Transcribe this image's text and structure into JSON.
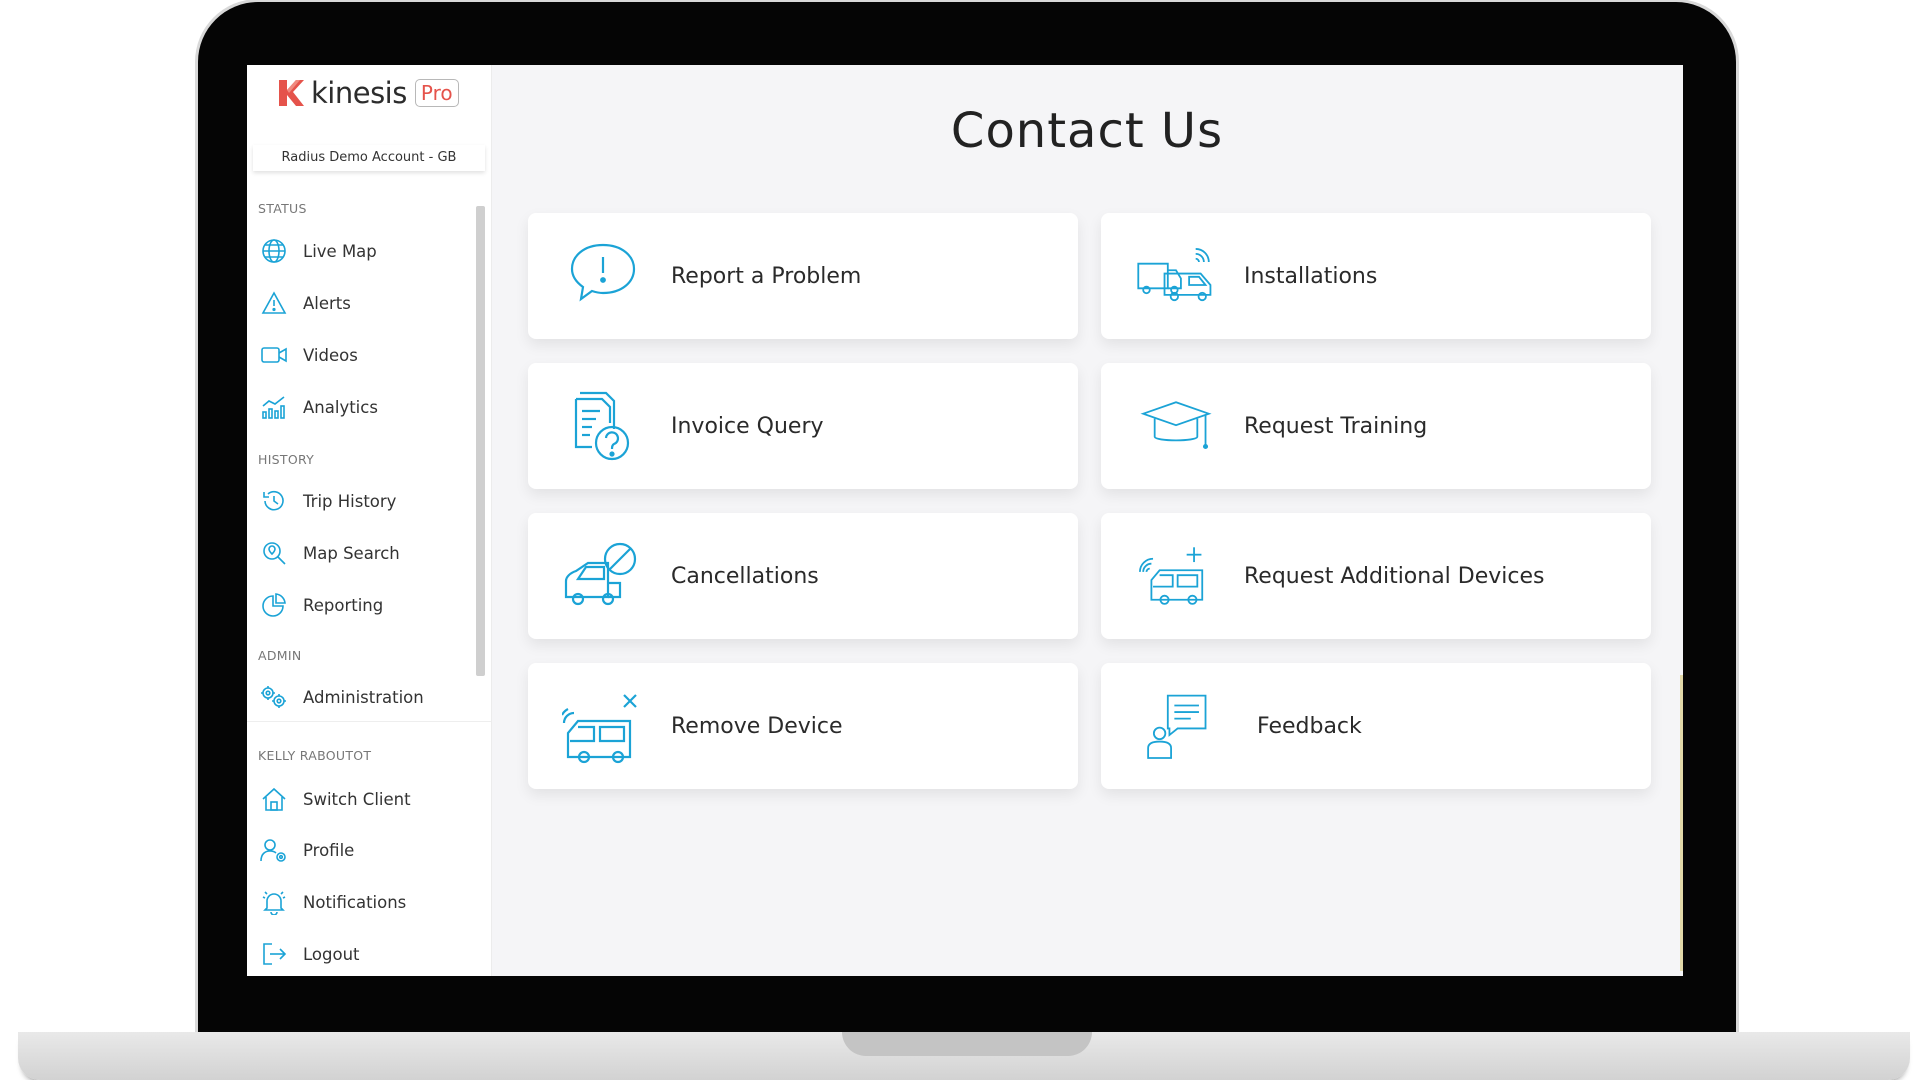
{
  "app": {
    "logo_text": "kinesis",
    "logo_badge": "Pro",
    "account": "Radius Demo Account - GB"
  },
  "sidebar": {
    "sections": [
      {
        "label": "STATUS",
        "items": [
          {
            "label": "Live Map",
            "icon": "globe-icon"
          },
          {
            "label": "Alerts",
            "icon": "warning-icon"
          },
          {
            "label": "Videos",
            "icon": "video-camera-icon"
          },
          {
            "label": "Analytics",
            "icon": "analytics-chart-icon"
          }
        ]
      },
      {
        "label": "HISTORY",
        "items": [
          {
            "label": "Trip History",
            "icon": "history-clock-icon"
          },
          {
            "label": "Map Search",
            "icon": "map-search-icon"
          },
          {
            "label": "Reporting",
            "icon": "pie-chart-icon"
          }
        ]
      },
      {
        "label": "ADMIN",
        "items": [
          {
            "label": "Administration",
            "icon": "gears-icon"
          }
        ]
      },
      {
        "label": "KELLY RABOUTOT",
        "items": [
          {
            "label": "Switch Client",
            "icon": "home-icon"
          },
          {
            "label": "Profile",
            "icon": "user-settings-icon"
          },
          {
            "label": "Notifications",
            "icon": "bell-icon"
          },
          {
            "label": "Logout",
            "icon": "logout-icon"
          }
        ]
      }
    ]
  },
  "main": {
    "title": "Contact Us",
    "cards": [
      {
        "label": "Report a Problem",
        "icon": "speech-bubble-alert-icon"
      },
      {
        "label": "Installations",
        "icon": "vehicles-signal-icon"
      },
      {
        "label": "Invoice Query",
        "icon": "invoice-question-icon"
      },
      {
        "label": "Request Training",
        "icon": "graduation-cap-icon"
      },
      {
        "label": "Cancellations",
        "icon": "van-cancel-icon"
      },
      {
        "label": "Request Additional Devices",
        "icon": "van-add-icon"
      },
      {
        "label": "Remove Device",
        "icon": "van-remove-icon"
      },
      {
        "label": "Feedback",
        "icon": "feedback-person-icon"
      }
    ]
  },
  "colors": {
    "accent": "#1ba3d6",
    "brand": "#e5534b",
    "text": "#2a2a2a"
  }
}
